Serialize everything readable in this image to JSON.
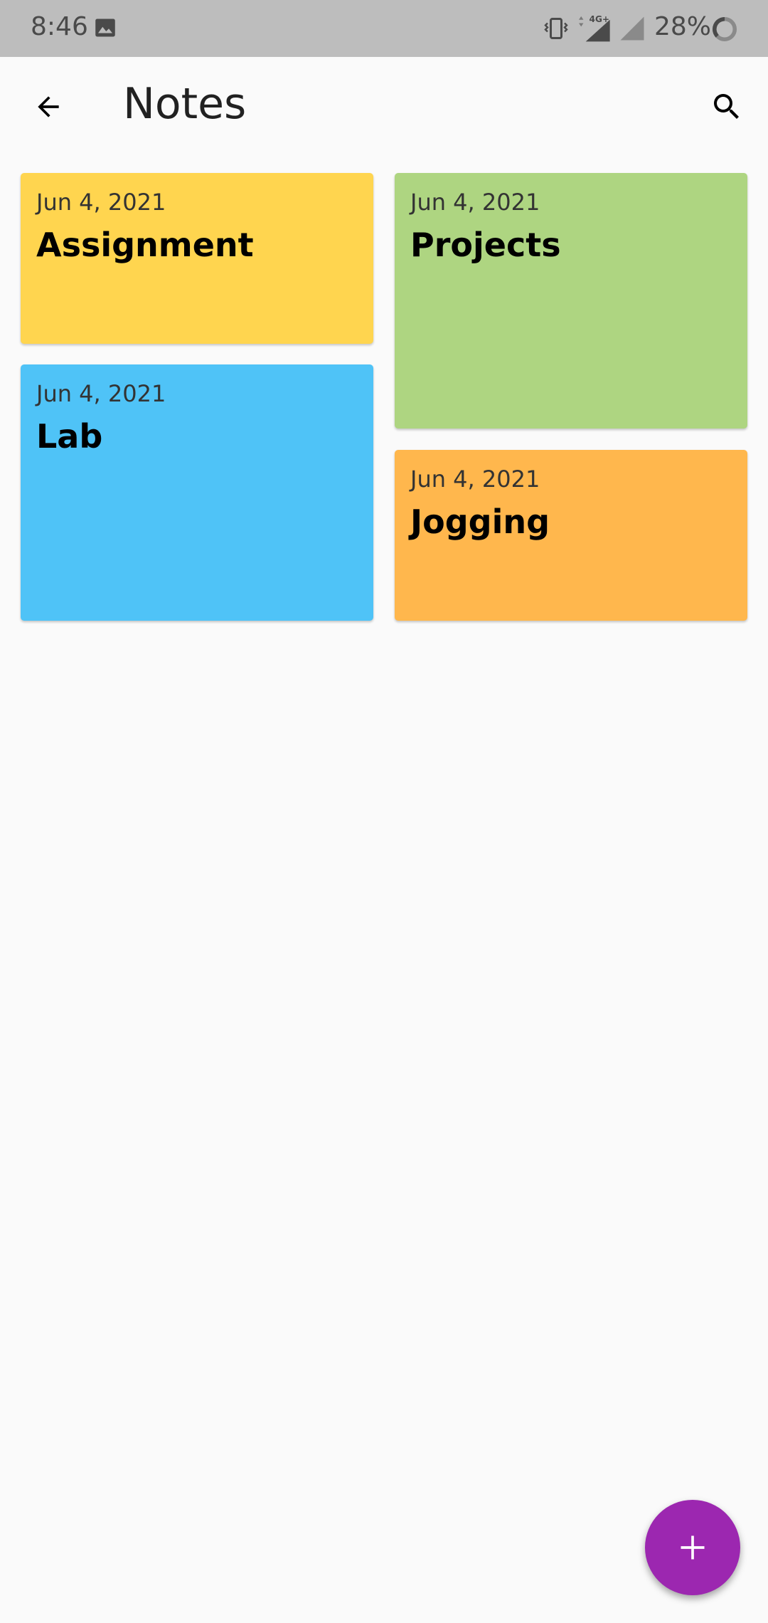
{
  "status_bar": {
    "time": "8:46",
    "network_label": "4G+",
    "battery": "28%",
    "icons": [
      "image-icon",
      "vibrate-icon",
      "signal-4g-icon",
      "signal-icon",
      "battery-icon"
    ]
  },
  "app_bar": {
    "title": "Notes",
    "back_icon": "arrow-back-icon",
    "search_icon": "search-icon"
  },
  "notes": [
    {
      "date": "Jun 4, 2021",
      "title": "Assignment",
      "color": "#ffd54f"
    },
    {
      "date": "Jun 4, 2021",
      "title": "Projects",
      "color": "#aed581"
    },
    {
      "date": "Jun 4, 2021",
      "title": "Lab",
      "color": "#4fc3f7"
    },
    {
      "date": "Jun 4, 2021",
      "title": "Jogging",
      "color": "#ffb74d"
    }
  ],
  "fab": {
    "icon": "plus-icon",
    "color": "#9c27b0"
  }
}
